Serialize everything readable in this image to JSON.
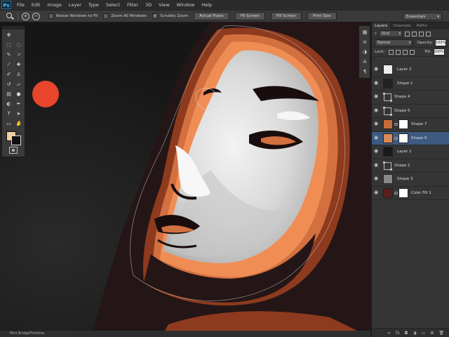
{
  "app": {
    "logo": "Ps"
  },
  "menu": [
    "File",
    "Edit",
    "Image",
    "Layer",
    "Type",
    "Select",
    "Filter",
    "3D",
    "View",
    "Window",
    "Help"
  ],
  "options": {
    "zoom_in": "+",
    "zoom_out": "−",
    "resize_windows": "Resize Windows to Fit",
    "zoom_all": "Zoom All Windows",
    "scrubby_zoom": "Scrubby Zoom",
    "buttons": [
      "Actual Pixels",
      "Fit Screen",
      "Fill Screen",
      "Print Size"
    ],
    "workspace": "Essentials"
  },
  "panel": {
    "tabs": [
      "Layers",
      "Channels",
      "Paths"
    ],
    "filter_kind": "Kind",
    "blend_mode": "Normal",
    "opacity_label": "Opacity:",
    "opacity_value": "100%",
    "lock_label": "Lock:",
    "fill_label": "Fill:",
    "fill_value": "100%",
    "footer_icons": [
      "link",
      "fx",
      "mask",
      "adjust",
      "folder",
      "new",
      "trash"
    ]
  },
  "layers": [
    {
      "name": "Layer 2",
      "kind": "raster"
    },
    {
      "name": "Shape 1",
      "kind": "smart"
    },
    {
      "name": "Shape 4",
      "kind": "shape"
    },
    {
      "name": "Shape 5",
      "kind": "shape"
    },
    {
      "name": "Shape 7",
      "kind": "masked"
    },
    {
      "name": "Shape 6",
      "kind": "masked",
      "selected": true
    },
    {
      "name": "Layer 1",
      "kind": "raster"
    },
    {
      "name": "Shape 2",
      "kind": "shape"
    },
    {
      "name": "Shape 3",
      "kind": "raster"
    },
    {
      "name": "Color Fill 1",
      "kind": "fill"
    }
  ],
  "status": {
    "tabs": [
      "Mini Bridge",
      "Timeline"
    ]
  },
  "colors": {
    "foreground": "#f1cfa0",
    "background": "#111111",
    "accent_dot": "#e8452c",
    "selection": "#3e5a80"
  }
}
